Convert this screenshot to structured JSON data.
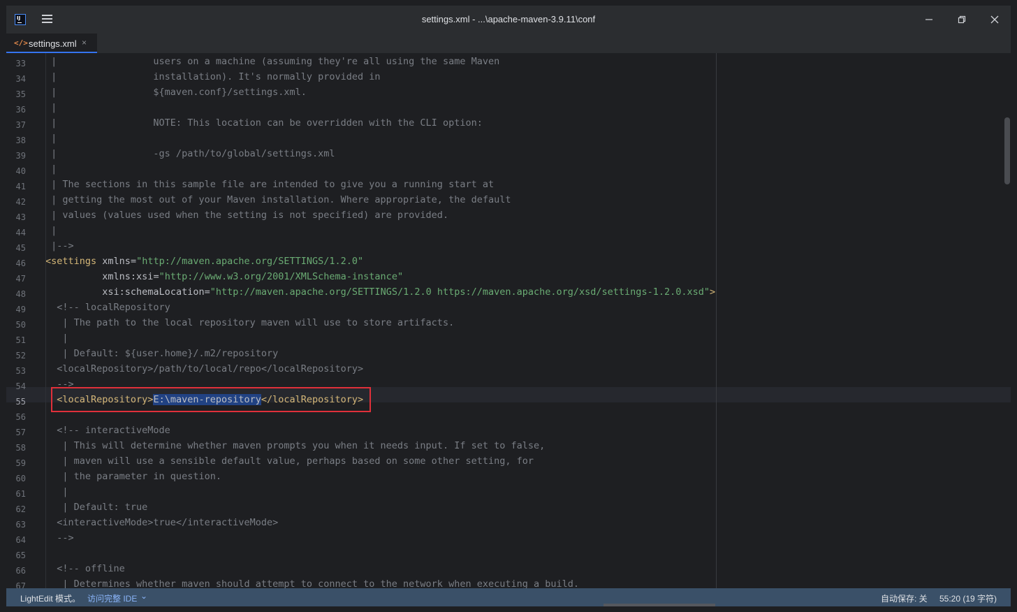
{
  "window": {
    "title": "settings.xml - ...\\apache-maven-3.9.11\\conf",
    "controls": {
      "minimize": "─",
      "restore": "❐",
      "close": "✕"
    }
  },
  "app_icon": {
    "text": "IJ"
  },
  "tab": {
    "label": "settings.xml",
    "icon": "</>",
    "close": "×"
  },
  "editor": {
    "current_line": 55,
    "lines": [
      {
        "num": "33",
        "html": "<span class=\"cmt\"> |                 users on a machine (assuming they're all using the same Maven</span>"
      },
      {
        "num": "34",
        "html": "<span class=\"cmt\"> |                 installation). It's normally provided in</span>"
      },
      {
        "num": "35",
        "html": "<span class=\"cmt\"> |                 ${maven.conf}/settings.xml.</span>"
      },
      {
        "num": "36",
        "html": "<span class=\"cmt\"> |</span>"
      },
      {
        "num": "37",
        "html": "<span class=\"cmt\"> |                 NOTE: This location can be overridden with the CLI option:</span>"
      },
      {
        "num": "38",
        "html": "<span class=\"cmt\"> |</span>"
      },
      {
        "num": "39",
        "html": "<span class=\"cmt\"> |                 -gs /path/to/global/settings.xml</span>"
      },
      {
        "num": "40",
        "html": "<span class=\"cmt\"> |</span>"
      },
      {
        "num": "41",
        "html": "<span class=\"cmt\"> | The sections in this sample file are intended to give you a running start at</span>"
      },
      {
        "num": "42",
        "html": "<span class=\"cmt\"> | getting the most out of your Maven installation. Where appropriate, the default</span>"
      },
      {
        "num": "43",
        "html": "<span class=\"cmt\"> | values (values used when the setting is not specified) are provided.</span>"
      },
      {
        "num": "44",
        "html": "<span class=\"cmt\"> |</span>"
      },
      {
        "num": "45",
        "html": "<span class=\"cmt\"> |--></span>"
      },
      {
        "num": "46",
        "html": "<span class=\"tag\">&lt;settings</span> <span class=\"an\">xmlns</span>=<span class=\"av\">\"http://maven.apache.org/SETTINGS/1.2.0\"</span>"
      },
      {
        "num": "47",
        "html": "          <span class=\"an\">xmlns:xsi</span>=<span class=\"av\">\"http://www.w3.org/2001/XMLSchema-instance\"</span>"
      },
      {
        "num": "48",
        "html": "          <span class=\"an\">xsi:schemaLocation</span>=<span class=\"av\">\"http://maven.apache.org/SETTINGS/1.2.0 https://maven.apache.org/xsd/settings-1.2.0.xsd\"</span><span class=\"tag\">&gt;</span>"
      },
      {
        "num": "49",
        "html": "<span class=\"cmt\">  &lt;!-- localRepository</span>"
      },
      {
        "num": "50",
        "html": "<span class=\"cmt\">   | The path to the local repository maven will use to store artifacts.</span>"
      },
      {
        "num": "51",
        "html": "<span class=\"cmt\">   |</span>"
      },
      {
        "num": "52",
        "html": "<span class=\"cmt\">   | Default: ${user.home}/.m2/repository</span>"
      },
      {
        "num": "53",
        "html": "<span class=\"cmt\">  &lt;localRepository&gt;/path/to/local/repo&lt;/localRepository&gt;</span>"
      },
      {
        "num": "54",
        "html": "<span class=\"cmt\">  --&gt;</span>"
      },
      {
        "num": "55",
        "html": "  <span class=\"tag\">&lt;localRepository&gt;</span><span class=\"sel\">E:\\maven-repository</span><span class=\"tag\">&lt;/localRepository&gt;</span>"
      },
      {
        "num": "56",
        "html": ""
      },
      {
        "num": "57",
        "html": "<span class=\"cmt\">  &lt;!-- interactiveMode</span>"
      },
      {
        "num": "58",
        "html": "<span class=\"cmt\">   | This will determine whether maven prompts you when it needs input. If set to false,</span>"
      },
      {
        "num": "59",
        "html": "<span class=\"cmt\">   | maven will use a sensible default value, perhaps based on some other setting, for</span>"
      },
      {
        "num": "60",
        "html": "<span class=\"cmt\">   | the parameter in question.</span>"
      },
      {
        "num": "61",
        "html": "<span class=\"cmt\">   |</span>"
      },
      {
        "num": "62",
        "html": "<span class=\"cmt\">   | Default: true</span>"
      },
      {
        "num": "63",
        "html": "<span class=\"cmt\">  &lt;interactiveMode&gt;true&lt;/interactiveMode&gt;</span>"
      },
      {
        "num": "64",
        "html": "<span class=\"cmt\">  --&gt;</span>"
      },
      {
        "num": "65",
        "html": ""
      },
      {
        "num": "66",
        "html": "<span class=\"cmt\">  &lt;!-- offline</span>"
      },
      {
        "num": "67",
        "html": "<span class=\"cmt\">   | Determines whether maven should attempt to connect to the network when executing a build.</span>"
      }
    ]
  },
  "statusbar": {
    "mode": "LightEdit 模式。",
    "ide_link": "访问完整 IDE",
    "ide_chevron": "⌄",
    "autosave": "自动保存: 关",
    "position": "55:20 (19 字符)"
  }
}
